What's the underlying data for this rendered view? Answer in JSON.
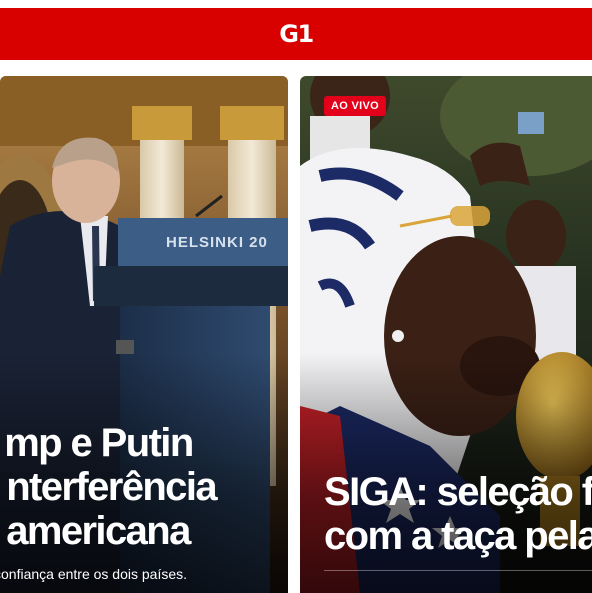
{
  "header": {
    "logo": "G1",
    "bg_color": "#d90000"
  },
  "cards": [
    {
      "headline": [
        "mp e Putin",
        "nterferência",
        " americana"
      ],
      "summary": " confiança entre os dois países.",
      "podium_text": "HELSINKI 20"
    },
    {
      "badge": "AO VIVO",
      "badge_color": "#e3001b",
      "headline": [
        "SIGA: seleção fr",
        "com a taça pela"
      ]
    }
  ]
}
